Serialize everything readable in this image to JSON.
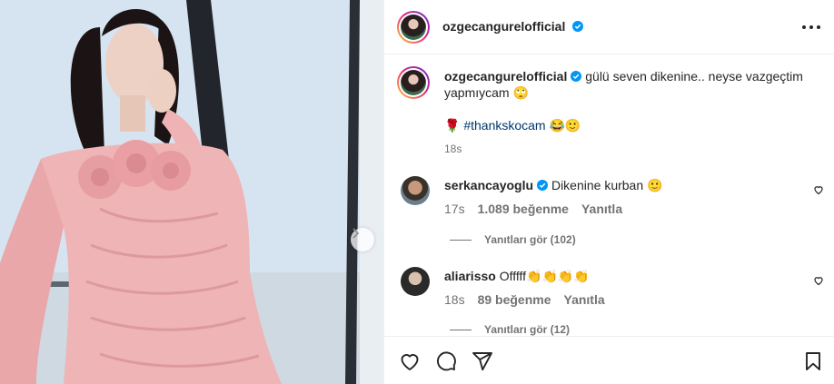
{
  "post": {
    "author": "ozgecangurelofficial",
    "caption_text": "gülü seven dikenine.. neyse vazgeçtim yapmıycam 🙄",
    "caption_line2_prefix": "🌹",
    "hashtag": "#thankskocam",
    "caption_line2_suffix": " 😂🙂",
    "time": "18s"
  },
  "comments": [
    {
      "username": "serkancayoglu",
      "verified": true,
      "text": "Dikenine kurban 🙂",
      "time": "17s",
      "likes": "1.089 beğenme",
      "reply": "Yanıtla",
      "view_replies": "Yanıtları gör (102)"
    },
    {
      "username": "aliarisso",
      "verified": false,
      "text": "Offfff👏👏👏👏",
      "time": "18s",
      "likes": "89 beğenme",
      "reply": "Yanıtla",
      "view_replies": "Yanıtları gör (12)"
    }
  ],
  "icons": {
    "like": "heart-icon",
    "comment": "comment-icon",
    "share": "share-icon",
    "save": "bookmark-icon",
    "more": "more-options-icon",
    "next": "chevron-right-icon",
    "verified": "verified-badge-icon"
  },
  "colors": {
    "verified": "#0095f6",
    "hashtag": "#00376b",
    "muted": "#737373",
    "text": "#262626"
  }
}
